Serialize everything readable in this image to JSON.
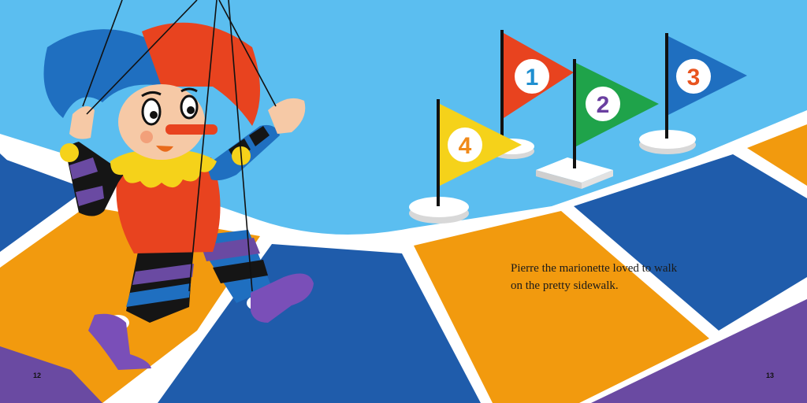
{
  "story": {
    "line1": "Pierre the marionette loved to walk",
    "line2": "on the pretty sidewalk."
  },
  "pages": {
    "left": "12",
    "right": "13"
  },
  "flags": [
    {
      "number": "1",
      "color": "#e8431f",
      "digit_color": "#1f8fd0"
    },
    {
      "number": "2",
      "color": "#1fa34a",
      "digit_color": "#6a3fa0"
    },
    {
      "number": "3",
      "color": "#1f6fc0",
      "digit_color": "#e8541f"
    },
    {
      "number": "4",
      "color": "#f5d21a",
      "digit_color": "#f08a1a"
    }
  ],
  "palette": {
    "sky": "#5bbef0",
    "path_orange": "#f29a0e",
    "path_blue": "#1f5cab",
    "ground_purple": "#6a4aa2",
    "border_white": "#ffffff"
  }
}
